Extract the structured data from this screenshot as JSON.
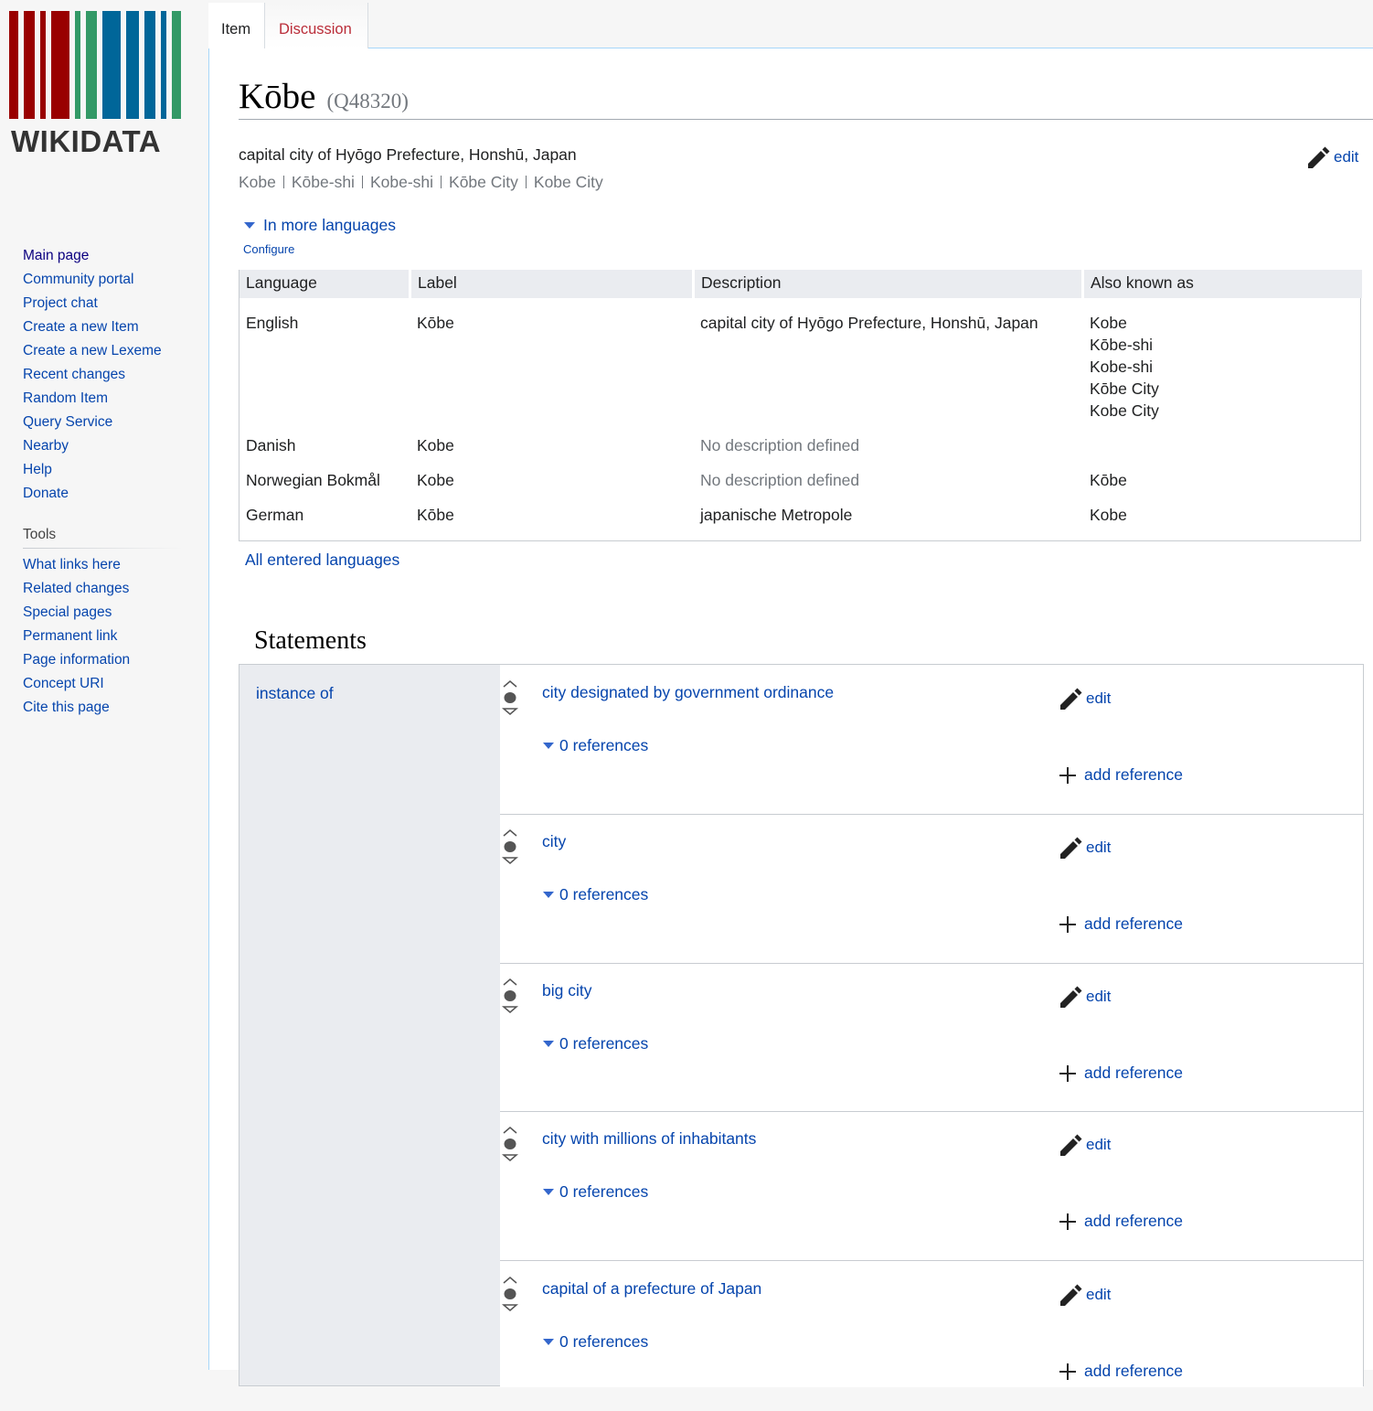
{
  "logo": {
    "wordmark": "WIKIDATA",
    "bar_colors": [
      "#990000",
      "#990000",
      "#990000",
      "#339966",
      "#339966",
      "#006699",
      "#006699",
      "#006699",
      "#339966"
    ]
  },
  "sidebar": {
    "navigation": [
      "Main page",
      "Community portal",
      "Project chat",
      "Create a new Item",
      "Create a new Lexeme",
      "Recent changes",
      "Random Item",
      "Query Service",
      "Nearby",
      "Help",
      "Donate"
    ],
    "tools_heading": "Tools",
    "tools": [
      "What links here",
      "Related changes",
      "Special pages",
      "Permanent link",
      "Page information",
      "Concept URI",
      "Cite this page"
    ]
  },
  "tabs": {
    "item": "Item",
    "discussion": "Discussion"
  },
  "item": {
    "label": "Kōbe",
    "id": "(Q48320)",
    "description": "capital city of Hyōgo Prefecture, Honshū, Japan",
    "aliases": [
      "Kobe",
      "Kōbe-shi",
      "Kobe-shi",
      "Kōbe City",
      "Kobe City"
    ],
    "edit_label": "edit"
  },
  "languages": {
    "toggle": "In more languages",
    "configure": "Configure",
    "headers": [
      "Language",
      "Label",
      "Description",
      "Also known as"
    ],
    "rows": [
      {
        "language": "English",
        "label": "Kōbe",
        "description": "capital city of Hyōgo Prefecture, Honshū, Japan",
        "aliases": [
          "Kobe",
          "Kōbe-shi",
          "Kobe-shi",
          "Kōbe City",
          "Kobe City"
        ]
      },
      {
        "language": "Danish",
        "label": "Kobe",
        "description": "No description defined",
        "aliases": []
      },
      {
        "language": "Norwegian Bokmål",
        "label": "Kobe",
        "description": "No description defined",
        "aliases": [
          "Kōbe"
        ]
      },
      {
        "language": "German",
        "label": "Kōbe",
        "description": "japanische Metropole",
        "aliases": [
          "Kobe"
        ]
      }
    ],
    "all_entered": "All entered languages"
  },
  "statements": {
    "heading": "Statements",
    "property": "instance of",
    "edit_label": "edit",
    "add_reference_label": "add reference",
    "values": [
      {
        "value": "city designated by government ordinance",
        "references": "0 references"
      },
      {
        "value": "city",
        "references": "0 references"
      },
      {
        "value": "big city",
        "references": "0 references"
      },
      {
        "value": "city with millions of inhabitants",
        "references": "0 references"
      },
      {
        "value": "capital of a prefecture of Japan",
        "references": "0 references"
      }
    ]
  }
}
